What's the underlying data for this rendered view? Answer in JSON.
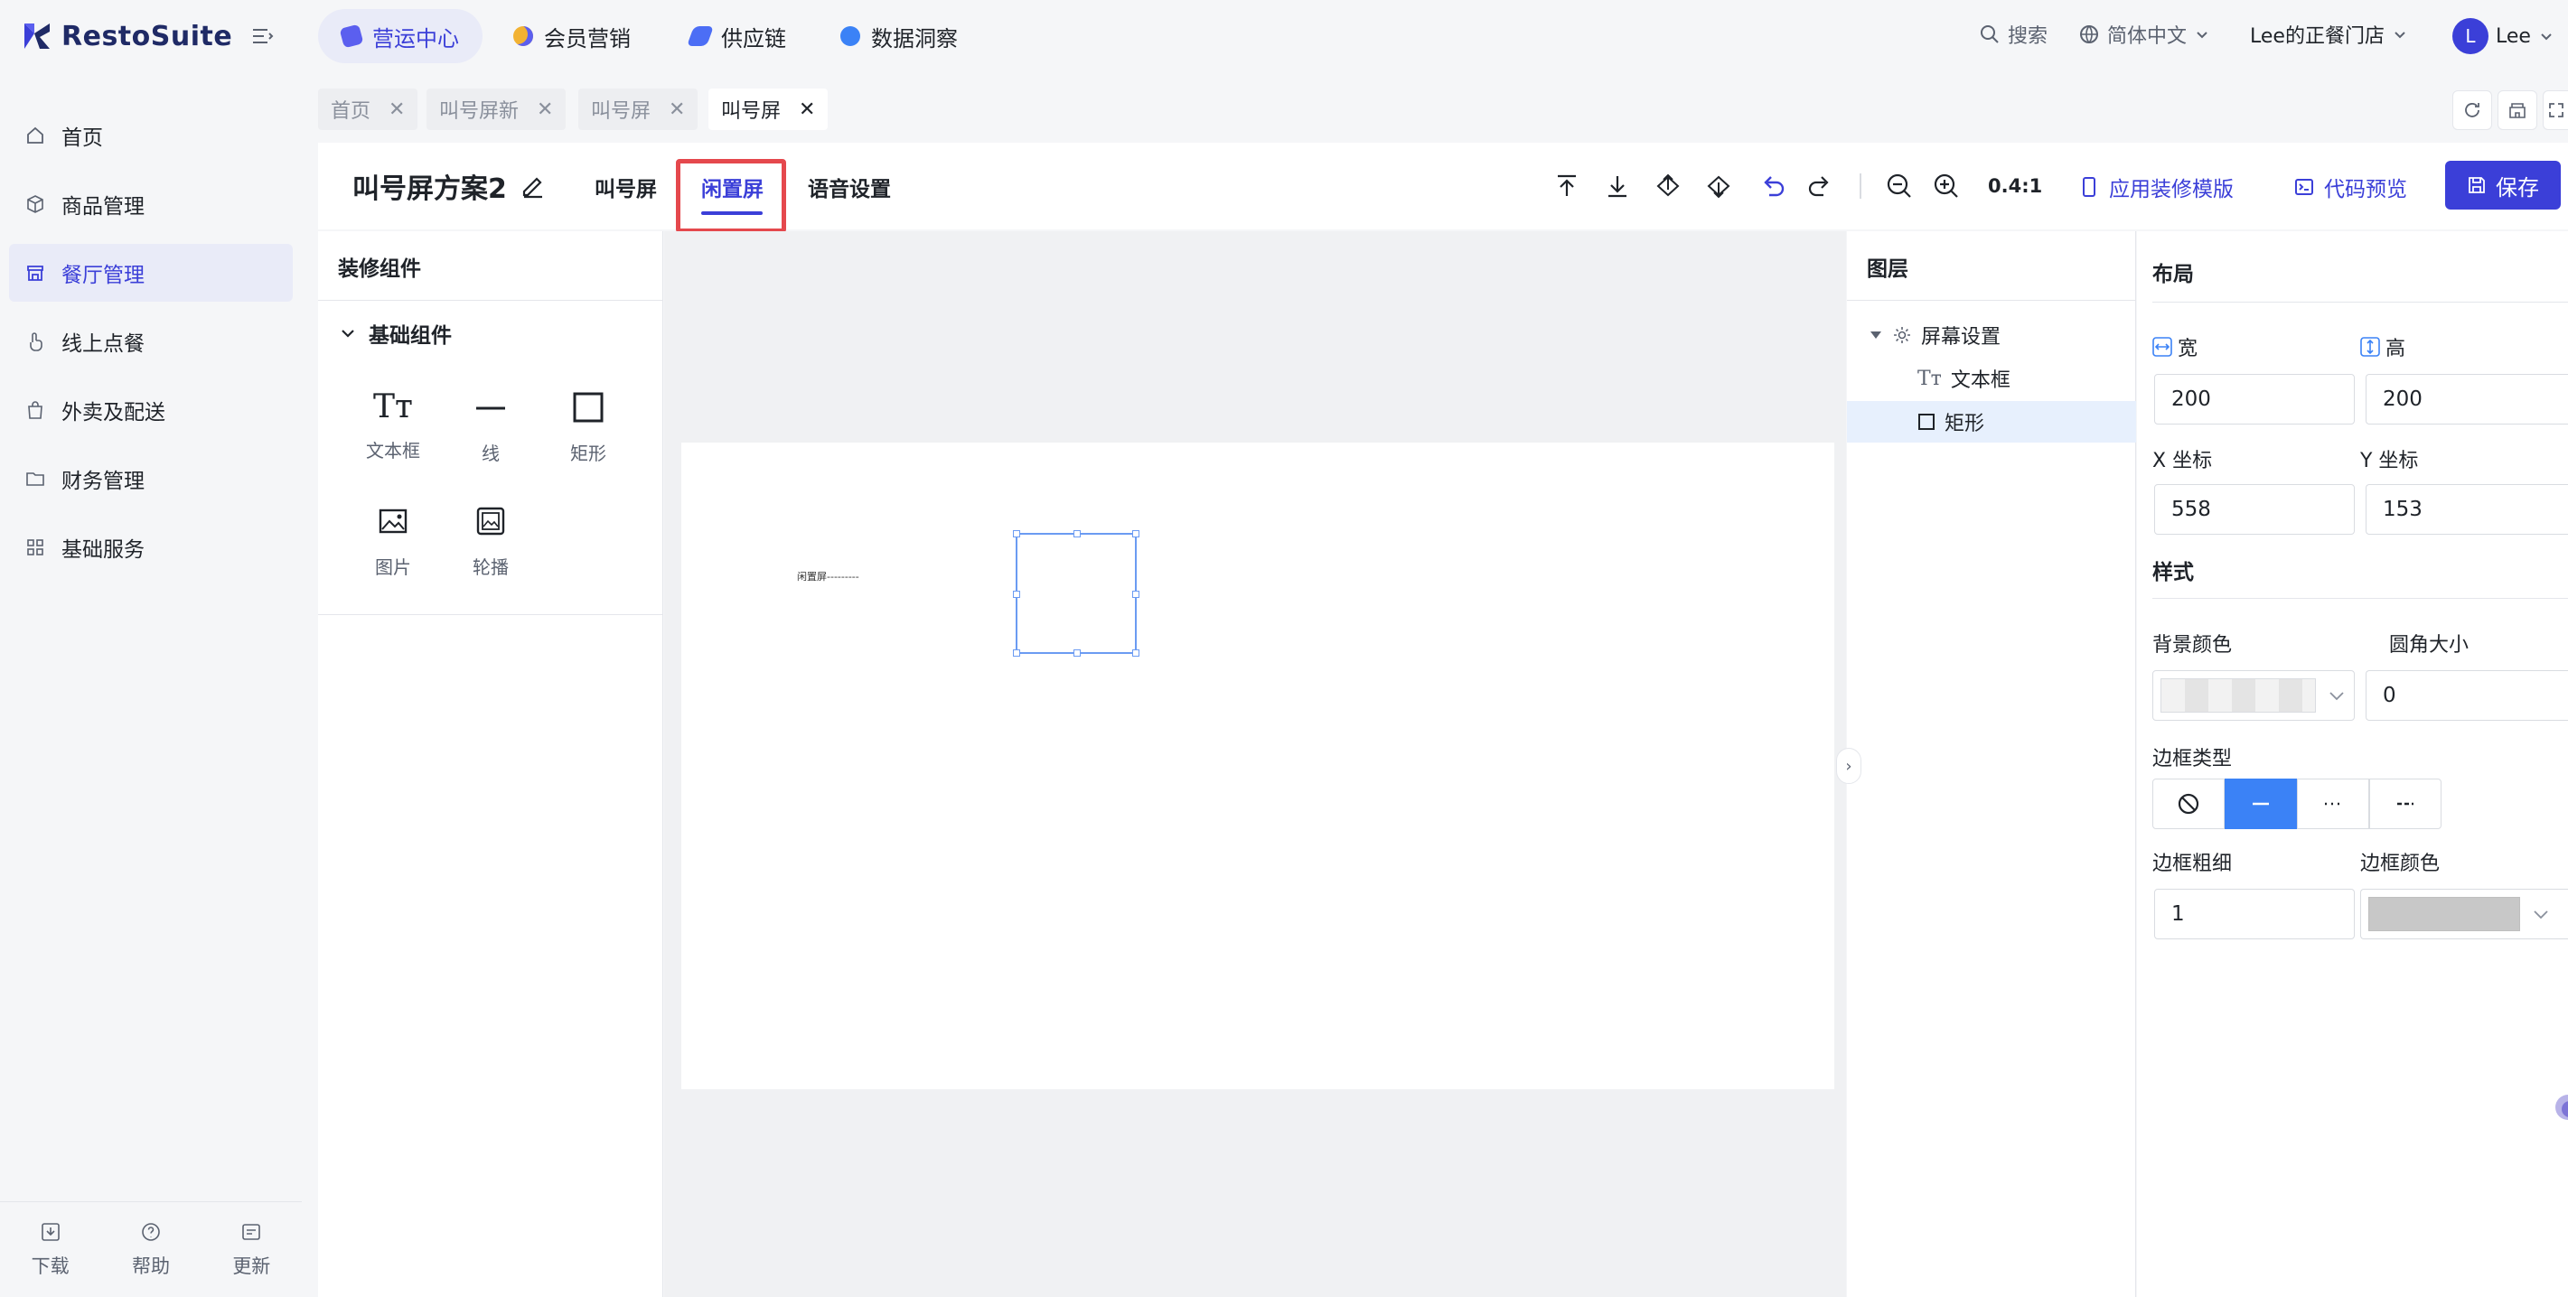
{
  "app": {
    "brand": "RestoSuite"
  },
  "topnav": {
    "items": [
      {
        "label": "营运中心",
        "active": true,
        "color": "#5b5fef"
      },
      {
        "label": "会员营销",
        "active": false,
        "color": "#f2b233"
      },
      {
        "label": "供应链",
        "active": false,
        "color": "#4c6ef5"
      },
      {
        "label": "数据洞察",
        "active": false,
        "color": "#3b82f6"
      }
    ],
    "search": "搜索",
    "language": "简体中文",
    "store": "Lee的正餐门店",
    "user_initial": "L",
    "user_name": "Lee"
  },
  "sidebar": {
    "items": [
      {
        "label": "首页",
        "icon": "home-icon"
      },
      {
        "label": "商品管理",
        "icon": "box-icon"
      },
      {
        "label": "餐厅管理",
        "icon": "store-icon",
        "active": true
      },
      {
        "label": "线上点餐",
        "icon": "hand-icon"
      },
      {
        "label": "外卖及配送",
        "icon": "bag-icon"
      },
      {
        "label": "财务管理",
        "icon": "folder-icon"
      },
      {
        "label": "基础服务",
        "icon": "grid-icon"
      }
    ],
    "footer": {
      "download": "下载",
      "help": "帮助",
      "update": "更新"
    }
  },
  "tabs": [
    {
      "label": "首页",
      "active": false
    },
    {
      "label": "叫号屏新",
      "active": false
    },
    {
      "label": "叫号屏",
      "active": false
    },
    {
      "label": "叫号屏",
      "active": true
    }
  ],
  "editor": {
    "title": "叫号屏方案2",
    "modes": [
      "叫号屏",
      "闲置屏",
      "语音设置"
    ],
    "active_mode": "闲置屏",
    "zoom": "0.4:1",
    "apply_template": "应用装修模版",
    "code_preview": "代码预览",
    "save": "保存"
  },
  "components": {
    "title": "装修组件",
    "group": "基础组件",
    "items": [
      "文本框",
      "线",
      "矩形",
      "图片",
      "轮播"
    ]
  },
  "canvas": {
    "text_content": "闲置屏---------"
  },
  "layers": {
    "title": "图层",
    "root": "屏幕设置",
    "children": [
      "文本框",
      "矩形"
    ],
    "selected": "矩形"
  },
  "properties": {
    "layout_title": "布局",
    "width_label": "宽",
    "height_label": "高",
    "width": "200",
    "height": "200",
    "x_label": "X 坐标",
    "y_label": "Y 坐标",
    "x": "558",
    "y": "153",
    "style_title": "样式",
    "bg_color_label": "背景颜色",
    "radius_label": "圆角大小",
    "radius": "0",
    "border_type_label": "边框类型",
    "border_types": [
      "none",
      "solid",
      "dotted",
      "dashed"
    ],
    "border_width_label": "边框粗细",
    "border_width": "1",
    "border_color_label": "边框颜色",
    "border_color": "#c8c8c8"
  }
}
